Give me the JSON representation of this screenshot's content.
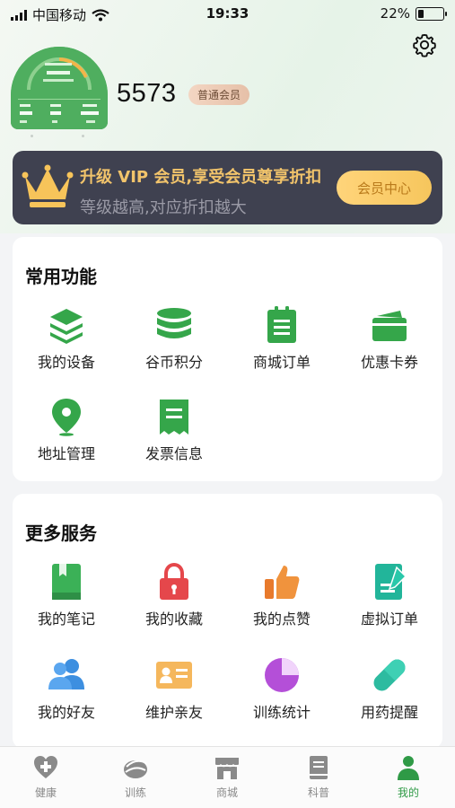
{
  "status_bar": {
    "carrier": "中国移动",
    "time": "19:33",
    "battery": "22%"
  },
  "profile": {
    "username": "5573",
    "member_level": "普通会员"
  },
  "vip_banner": {
    "title": "升级 VIP 会员,享受会员尊享折扣",
    "subtitle": "等级越高,对应折扣越大",
    "button": "会员中心"
  },
  "common_functions": {
    "title": "常用功能",
    "items": [
      {
        "label": "我的设备",
        "icon": "layers-icon"
      },
      {
        "label": "谷币积分",
        "icon": "coins-icon"
      },
      {
        "label": "商城订单",
        "icon": "clipboard-icon"
      },
      {
        "label": "优惠卡券",
        "icon": "wallet-icon"
      },
      {
        "label": "地址管理",
        "icon": "location-pin-icon"
      },
      {
        "label": "发票信息",
        "icon": "receipt-icon"
      }
    ]
  },
  "more_services": {
    "title": "更多服务",
    "items": [
      {
        "label": "我的笔记",
        "icon": "notebook-icon"
      },
      {
        "label": "我的收藏",
        "icon": "lock-icon"
      },
      {
        "label": "我的点赞",
        "icon": "thumbs-up-icon"
      },
      {
        "label": "虚拟订单",
        "icon": "document-edit-icon"
      },
      {
        "label": "我的好友",
        "icon": "friends-icon"
      },
      {
        "label": "维护亲友",
        "icon": "id-card-icon"
      },
      {
        "label": "训练统计",
        "icon": "pie-chart-icon"
      },
      {
        "label": "用药提醒",
        "icon": "pill-icon"
      }
    ]
  },
  "tab_bar": {
    "tabs": [
      {
        "label": "健康",
        "icon": "health-heart-icon"
      },
      {
        "label": "训练",
        "icon": "training-icon"
      },
      {
        "label": "商城",
        "icon": "store-icon"
      },
      {
        "label": "科普",
        "icon": "book-icon"
      },
      {
        "label": "我的",
        "icon": "person-icon",
        "active": true
      }
    ]
  },
  "colors": {
    "accent_green": "#2f9a46",
    "vip_gold": "#f2c46b",
    "banner_bg": "#3f4150"
  }
}
